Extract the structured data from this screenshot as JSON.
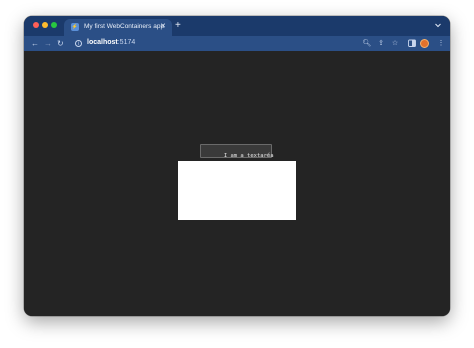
{
  "browser": {
    "tab": {
      "title": "My first WebContainers app",
      "favicon_icon": "webcontainer-favicon-icon"
    },
    "toolbar": {
      "url_host": "localhost",
      "url_port": ":5174"
    },
    "colors": {
      "tabstrip": "#1b3a6b",
      "toolbar": "#2b4f86",
      "page_background": "#242424"
    }
  },
  "page": {
    "textarea": {
      "value": "I am a textarea"
    },
    "preview_frame": {
      "content": ""
    }
  }
}
